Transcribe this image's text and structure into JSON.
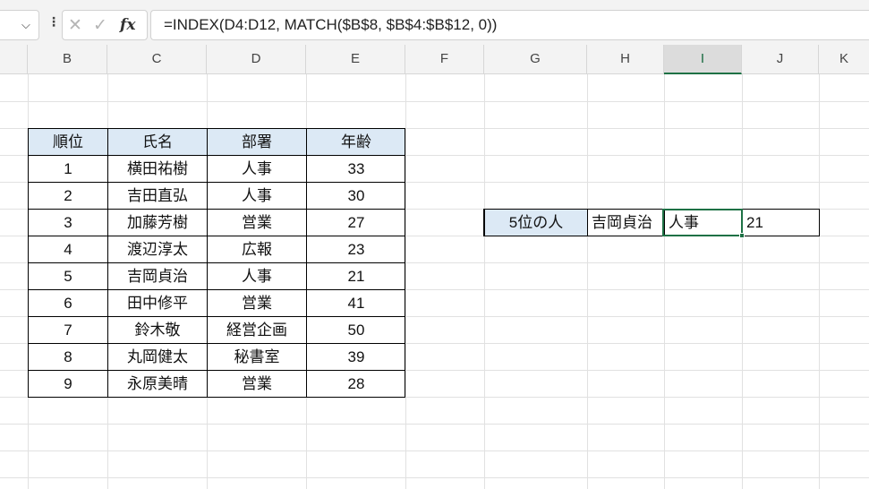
{
  "formula_bar": {
    "name_box_chevron": "⌵",
    "dots": "⋮",
    "cancel_icon": "✕",
    "enter_icon": "✓",
    "fx_label": "fx",
    "formula": "=INDEX(D4:D12, MATCH($B$8, $B$4:$B$12, 0))"
  },
  "columns": [
    "B",
    "C",
    "D",
    "E",
    "F",
    "G",
    "H",
    "I",
    "J",
    "K"
  ],
  "selected_column": "I",
  "table": {
    "headers": [
      "順位",
      "氏名",
      "部署",
      "年齢"
    ],
    "rows": [
      [
        "1",
        "横田祐樹",
        "人事",
        "33"
      ],
      [
        "2",
        "吉田直弘",
        "人事",
        "30"
      ],
      [
        "3",
        "加藤芳樹",
        "営業",
        "27"
      ],
      [
        "4",
        "渡辺淳太",
        "広報",
        "23"
      ],
      [
        "5",
        "吉岡貞治",
        "人事",
        "21"
      ],
      [
        "6",
        "田中修平",
        "営業",
        "41"
      ],
      [
        "7",
        "鈴木敬",
        "経営企画",
        "50"
      ],
      [
        "8",
        "丸岡健太",
        "秘書室",
        "39"
      ],
      [
        "9",
        "永原美晴",
        "営業",
        "28"
      ]
    ]
  },
  "lookup": {
    "label": "5位の人",
    "name": "吉岡貞治",
    "department": "人事",
    "age": "21"
  },
  "colors": {
    "header_fill": "#dce9f5",
    "accent_green": "#1e7145",
    "gridline": "#e1e1e1"
  }
}
